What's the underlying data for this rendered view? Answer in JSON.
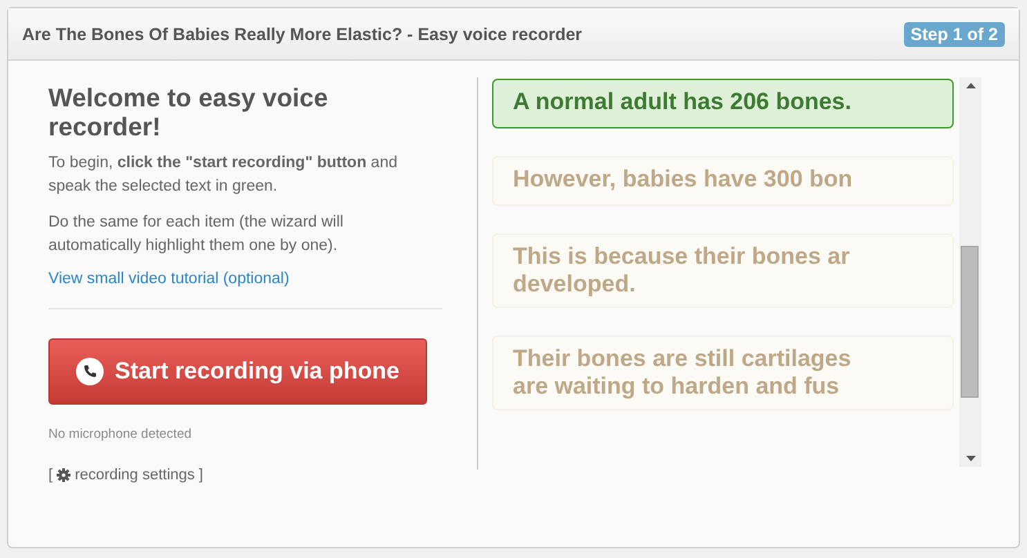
{
  "window": {
    "title": "Are The Bones Of Babies Really More Elastic? - Easy voice recorder",
    "step_badge": "Step 1 of 2"
  },
  "intro": {
    "heading": "Welcome to easy voice recorder!",
    "paragraphs": [
      "To begin, **click the \"start recording\" button** and speak the selected text in green.",
      "Do the same for each item (the wizard will automatically highlight them one by one)."
    ],
    "tutorial_link": "View small video tutorial (optional)"
  },
  "record_button": {
    "label": "Start recording via phone"
  },
  "mic_status": "No microphone detected",
  "settings_link": {
    "open": "[",
    "label": "recording settings",
    "close": "]"
  },
  "sentences": [
    {
      "lines": [
        "A normal adult has 206 bones."
      ],
      "selected": true
    },
    {
      "lines": [
        "However, babies have 300 bon"
      ],
      "selected": false
    },
    {
      "lines": [
        "This is because their bones ar",
        "developed."
      ],
      "selected": false
    },
    {
      "lines": [
        "Their bones are still cartilages",
        "are waiting to harden and fus"
      ],
      "selected": false
    }
  ]
}
